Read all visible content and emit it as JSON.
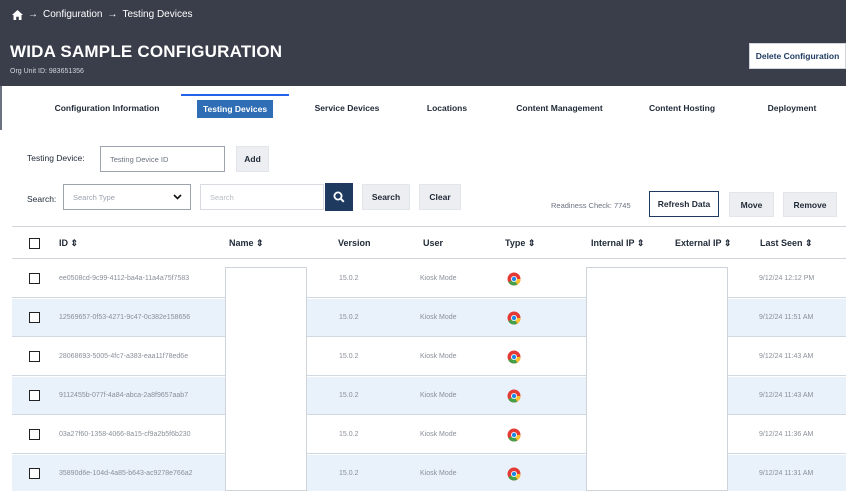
{
  "breadcrumb": {
    "home_icon": "home-icon",
    "items": [
      "Configuration",
      "Testing Devices"
    ],
    "separator": "→"
  },
  "header": {
    "title": "WIDA SAMPLE CONFIGURATION",
    "org_unit": "Org Unit ID: 983651356",
    "delete_button": "Delete Configuration"
  },
  "tabs": [
    {
      "label": "Configuration Information",
      "active": false
    },
    {
      "label": "Testing Devices",
      "active": true
    },
    {
      "label": "Service Devices",
      "active": false
    },
    {
      "label": "Locations",
      "active": false
    },
    {
      "label": "Content Management",
      "active": false
    },
    {
      "label": "Content Hosting",
      "active": false
    },
    {
      "label": "Deployment",
      "active": false
    }
  ],
  "testing_device": {
    "label": "Testing Device:",
    "placeholder": "Testing Device ID",
    "add_button": "Add"
  },
  "search": {
    "label": "Search:",
    "type_placeholder": "Search Type",
    "input_placeholder": "Search",
    "search_button": "Search",
    "clear_button": "Clear"
  },
  "readiness": {
    "text": "Readiness Check: 7745",
    "refresh_button": "Refresh Data",
    "move_button": "Move",
    "remove_button": "Remove"
  },
  "table": {
    "columns": {
      "id": "ID",
      "name": "Name",
      "version": "Version",
      "user": "User",
      "type": "Type",
      "internal_ip": "Internal IP",
      "external_ip": "External IP",
      "last_seen": "Last Seen"
    },
    "sort_icon": "sort-icon",
    "rows": [
      {
        "id": "ee0508cd-9c99-4112-ba4a-11a4a75f7583",
        "version": "15.0.2",
        "user": "Kiosk Mode",
        "type_icon": "chrome-icon",
        "last_seen": "9/12/24 12:12 PM"
      },
      {
        "id": "12569657-0f53-4271-9c47-0c382e158656",
        "version": "15.0.2",
        "user": "Kiosk Mode",
        "type_icon": "chrome-icon",
        "last_seen": "9/12/24 11:51 AM"
      },
      {
        "id": "28068693-5005-4fc7-a383-eaa11f78ed6e",
        "version": "15.0.2",
        "user": "Kiosk Mode",
        "type_icon": "chrome-icon",
        "last_seen": "9/12/24 11:43 AM"
      },
      {
        "id": "9112455b-077f-4a84-abca-2a8f9657aab7",
        "version": "15.0.2",
        "user": "Kiosk Mode",
        "type_icon": "chrome-icon",
        "last_seen": "9/12/24 11:43 AM"
      },
      {
        "id": "03a27f60-1358-4066-8a15-cf9a2b5f6b230",
        "version": "15.0.2",
        "user": "Kiosk Mode",
        "type_icon": "chrome-icon",
        "last_seen": "9/12/24 11:36 AM"
      },
      {
        "id": "35890d6e-104d-4a85-b643-ac9278e766a2",
        "version": "15.0.2",
        "user": "Kiosk Mode",
        "type_icon": "chrome-icon",
        "last_seen": "9/12/24 11:31 AM"
      }
    ]
  },
  "colors": {
    "header_bg": "#3a3e4a",
    "active_tab": "#2f6db5",
    "search_button": "#1e3a5f",
    "row_alt": "#e9f1fb"
  }
}
